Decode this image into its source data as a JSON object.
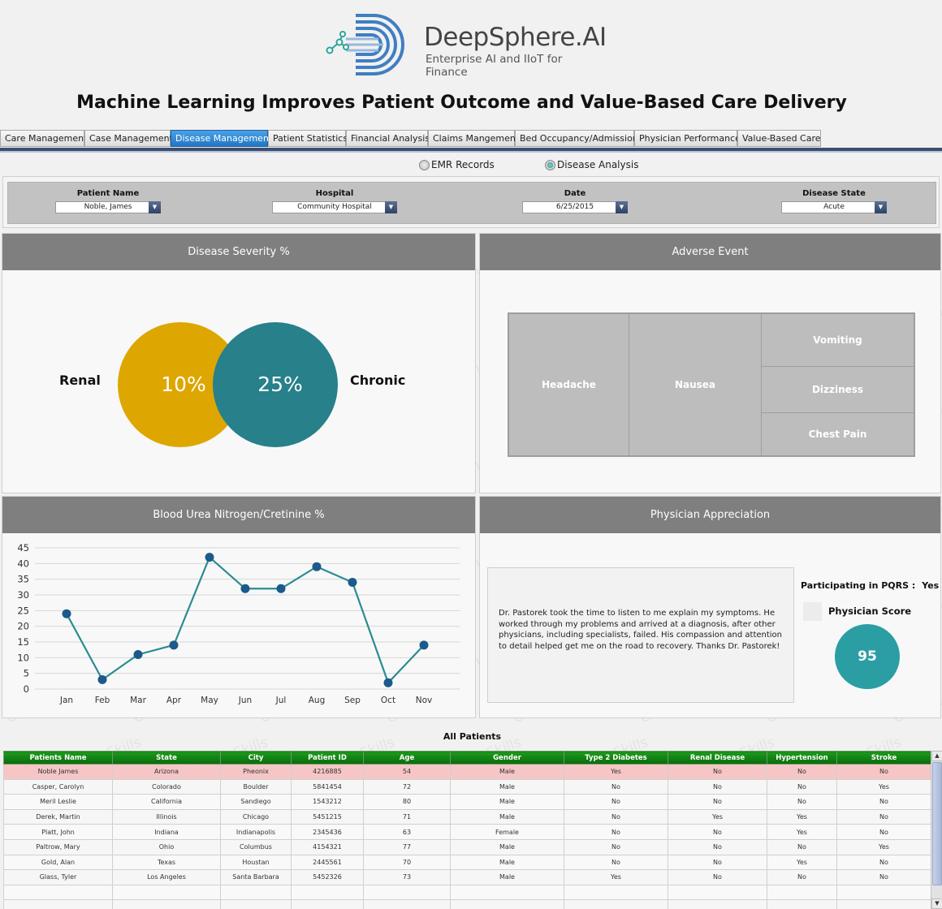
{
  "header": {
    "brand_name": "DeepSphere.AI",
    "brand_tagline": "Enterprise AI and IIoT for Finance",
    "title": "Machine Learning Improves Patient Outcome and Value-Based Care Delivery"
  },
  "tabs": [
    {
      "label": "Care Management",
      "active": false
    },
    {
      "label": "Case Management",
      "active": false
    },
    {
      "label": "Disease Management",
      "active": true
    },
    {
      "label": "Patient Statistics",
      "active": false
    },
    {
      "label": "Financial Analysis",
      "active": false
    },
    {
      "label": "Claims Mangement",
      "active": false
    },
    {
      "label": "Bed Occupancy/Admission",
      "active": false
    },
    {
      "label": "Physician Performance",
      "active": false
    },
    {
      "label": "Value-Based Care",
      "active": false
    }
  ],
  "radios": {
    "emr": {
      "label": "EMR Records",
      "selected": false
    },
    "disease": {
      "label": "Disease Analysis",
      "selected": true
    }
  },
  "filters": {
    "patient": {
      "label": "Patient Name",
      "value": "Noble, James"
    },
    "hospital": {
      "label": "Hospital",
      "value": "Community Hospital"
    },
    "date": {
      "label": "Date",
      "value": "6/25/2015"
    },
    "state": {
      "label": "Disease State",
      "value": "Acute"
    }
  },
  "severity": {
    "title": "Disease Severity %",
    "left_label": "Renal",
    "left_value": "10%",
    "left_color": "#dea600",
    "right_label": "Chronic",
    "right_value": "25%",
    "right_color": "#27808a"
  },
  "adverse": {
    "title": "Adverse Event",
    "cells": [
      "Headache",
      "Nausea",
      "Vomiting",
      "Dizziness",
      "Chest Pain"
    ]
  },
  "bun": {
    "title": "Blood Urea Nitrogen/Cretinine %"
  },
  "chart_data": {
    "type": "line",
    "title": "",
    "categories": [
      "Jan",
      "Feb",
      "Mar",
      "Apr",
      "May",
      "Jun",
      "Jul",
      "Aug",
      "Sep",
      "Oct",
      "Nov"
    ],
    "values": [
      24,
      3,
      11,
      14,
      42,
      32,
      32,
      39,
      34,
      2,
      14
    ],
    "ylim": [
      0,
      45
    ],
    "yticks": [
      0,
      5,
      10,
      15,
      20,
      25,
      30,
      35,
      40,
      45
    ],
    "grid": true,
    "line_color": "#2a8c92",
    "marker_color": "#1b5a8a"
  },
  "appreciation": {
    "title": "Physician Appreciation",
    "comment": "Dr. Pastorek took the time to listen to me explain my symptoms. He worked through my problems and arrived at a diagnosis, after other physicians, including specialists, failed. His compassion and attention to detail helped get me on the road to recovery. Thanks Dr. Pastorek!",
    "pqrs_label": "Participating in PQRS :",
    "pqrs_value": "Yes",
    "score_label": "Physician Score",
    "score": "95"
  },
  "patients": {
    "title": "All Patients",
    "columns": [
      "Patients Name",
      "State",
      "City",
      "Patient ID",
      "Age",
      "Gender",
      "Type 2 Diabetes",
      "Renal Disease",
      "Hypertension",
      "Stroke"
    ],
    "rows": [
      [
        "Noble James",
        "Arizona",
        "Pheonix",
        "4216885",
        "54",
        "Male",
        "Yes",
        "No",
        "No",
        "No"
      ],
      [
        "Casper, Carolyn",
        "Colorado",
        "Boulder",
        "5841454",
        "72",
        "Male",
        "No",
        "No",
        "No",
        "Yes"
      ],
      [
        "Meril Leslie",
        "California",
        "Sandiego",
        "1543212",
        "80",
        "Male",
        "No",
        "No",
        "No",
        "No"
      ],
      [
        "Derek, Martin",
        "Illinois",
        "Chicago",
        "5451215",
        "71",
        "Male",
        "No",
        "Yes",
        "Yes",
        "No"
      ],
      [
        "Platt, John",
        "Indiana",
        "Indianapolis",
        "2345436",
        "63",
        "Female",
        "No",
        "No",
        "Yes",
        "No"
      ],
      [
        "Paltrow, Mary",
        "Ohio",
        "Columbus",
        "4154321",
        "77",
        "Male",
        "No",
        "No",
        "No",
        "Yes"
      ],
      [
        "Gold, Alan",
        "Texas",
        "Houstan",
        "2445561",
        "70",
        "Male",
        "No",
        "No",
        "Yes",
        "No"
      ],
      [
        "Glass, Tyler",
        "Los Angeles",
        "Santa Barbara",
        "5452326",
        "73",
        "Male",
        "Yes",
        "No",
        "No",
        "No"
      ]
    ],
    "selected_row": 0
  },
  "watermark": "CloneSkills"
}
